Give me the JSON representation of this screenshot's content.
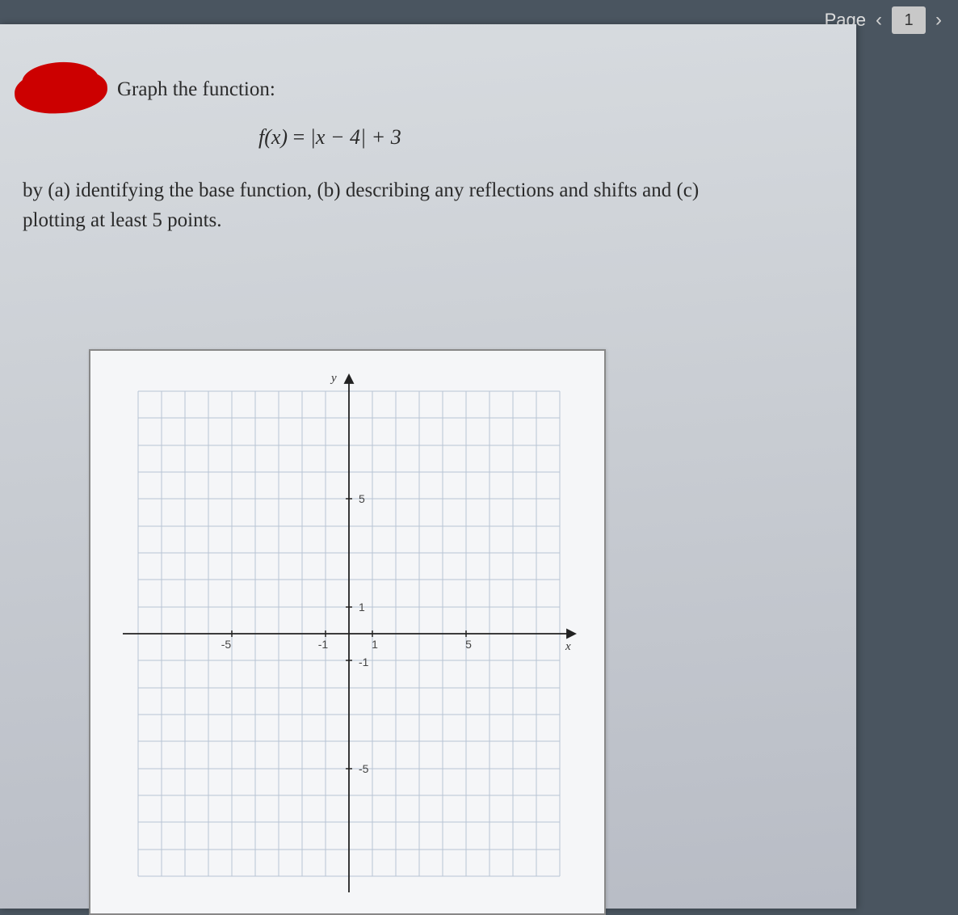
{
  "nav": {
    "label": "Page",
    "current": "1"
  },
  "problem": {
    "prompt": "Graph the function:",
    "equation_lhs": "f(x)",
    "equation_rhs": "|x − 4| + 3",
    "instructions": "by (a) identifying the base function, (b) describing any reflections and shifts and (c) plotting at least 5 points."
  },
  "chart_data": {
    "type": "scatter",
    "title": "",
    "xlabel": "x",
    "ylabel": "y",
    "xlim": [
      -9,
      9
    ],
    "ylim": [
      -9,
      9
    ],
    "x_ticks": [
      -5,
      -1,
      1,
      5
    ],
    "y_ticks": [
      -5,
      -1,
      1,
      5
    ],
    "grid": true,
    "series": []
  }
}
